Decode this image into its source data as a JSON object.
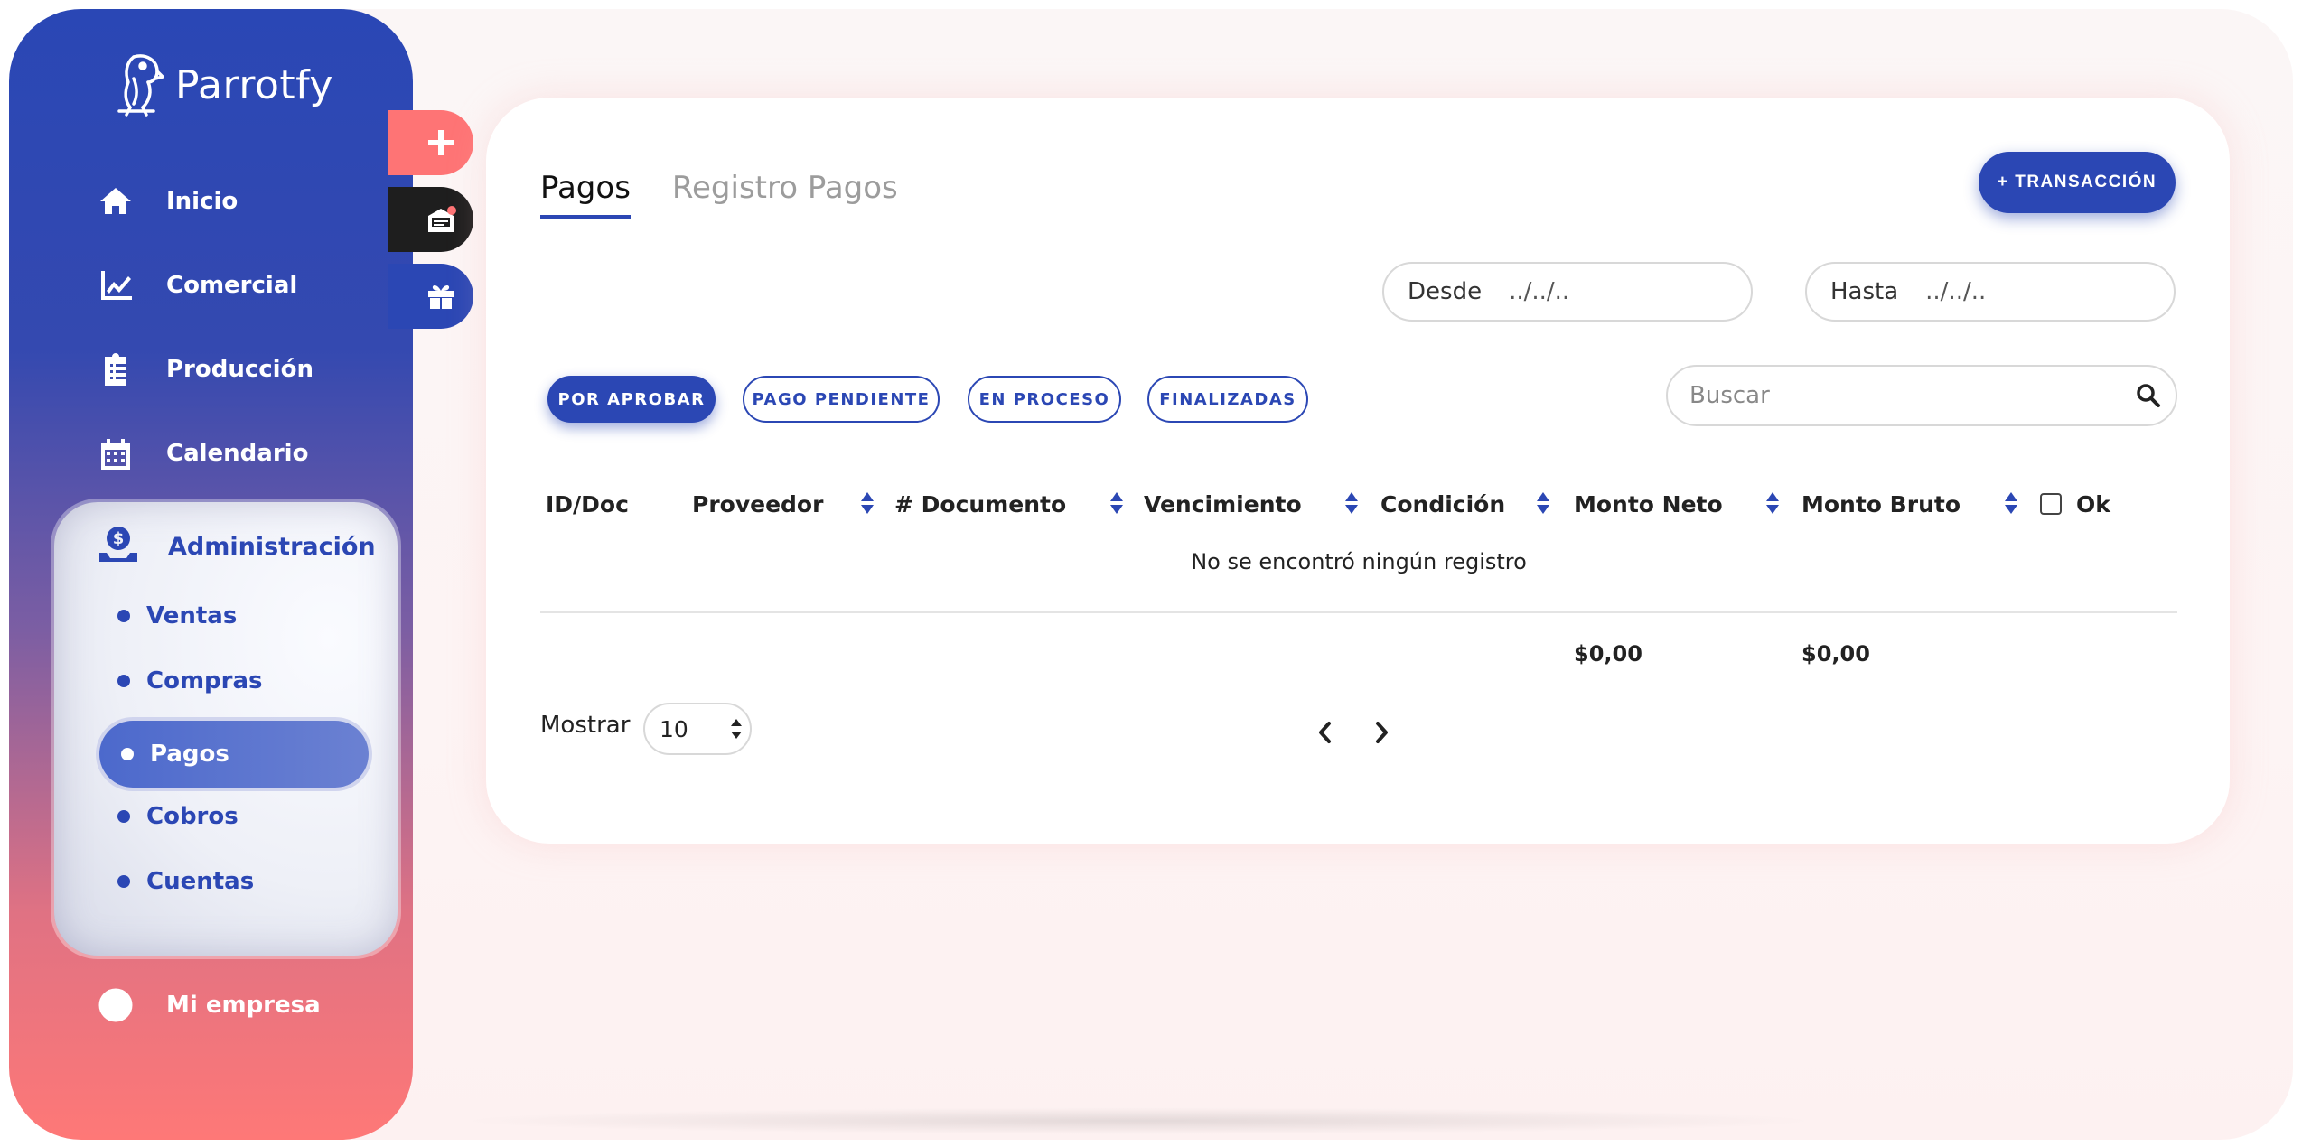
{
  "brand": {
    "name": "Parrotfy"
  },
  "sidebar": {
    "items": [
      {
        "label": "Inicio",
        "icon": "home-icon"
      },
      {
        "label": "Comercial",
        "icon": "chart-line-icon"
      },
      {
        "label": "Producción",
        "icon": "clipboard-icon"
      },
      {
        "label": "Calendario",
        "icon": "calendar-icon"
      }
    ],
    "admin": {
      "label": "Administración",
      "icon": "money-hand-icon",
      "subitems": [
        {
          "label": "Ventas"
        },
        {
          "label": "Compras"
        },
        {
          "label": "Pagos",
          "active": true
        },
        {
          "label": "Cobros"
        },
        {
          "label": "Cuentas"
        }
      ]
    },
    "footer": {
      "label": "Mi empresa",
      "icon": "user-circle-icon"
    }
  },
  "fabs": [
    {
      "icon": "plus-icon",
      "color": "#fe7475"
    },
    {
      "icon": "mail-notification-icon",
      "color": "#1e1e1e"
    },
    {
      "icon": "gift-icon",
      "color": "#2b47b4"
    }
  ],
  "main": {
    "tabs": [
      {
        "label": "Pagos",
        "active": true
      },
      {
        "label": "Registro Pagos",
        "active": false
      }
    ],
    "transaction_button": "+ TRANSACCIÓN",
    "date_from": {
      "label": "Desde",
      "value": "../../.."
    },
    "date_to": {
      "label": "Hasta",
      "value": "../../.."
    },
    "filters": [
      {
        "label": "POR APROBAR",
        "active": true
      },
      {
        "label": "PAGO PENDIENTE",
        "active": false
      },
      {
        "label": "EN PROCESO",
        "active": false
      },
      {
        "label": "FINALIZADAS",
        "active": false
      }
    ],
    "search": {
      "placeholder": "Buscar"
    },
    "table": {
      "columns": [
        "ID/Doc",
        "Proveedor",
        "# Documento",
        "Vencimiento",
        "Condición",
        "Monto Neto",
        "Monto Bruto",
        "Ok"
      ],
      "empty_message": "No se encontró ningún registro",
      "totals": {
        "neto": "$0,00",
        "bruto": "$0,00"
      }
    },
    "pagination": {
      "show_label": "Mostrar",
      "page_size": "10"
    }
  },
  "colors": {
    "primary": "#2b47b4",
    "accent": "#fe7475",
    "dark": "#1e1e1e"
  }
}
